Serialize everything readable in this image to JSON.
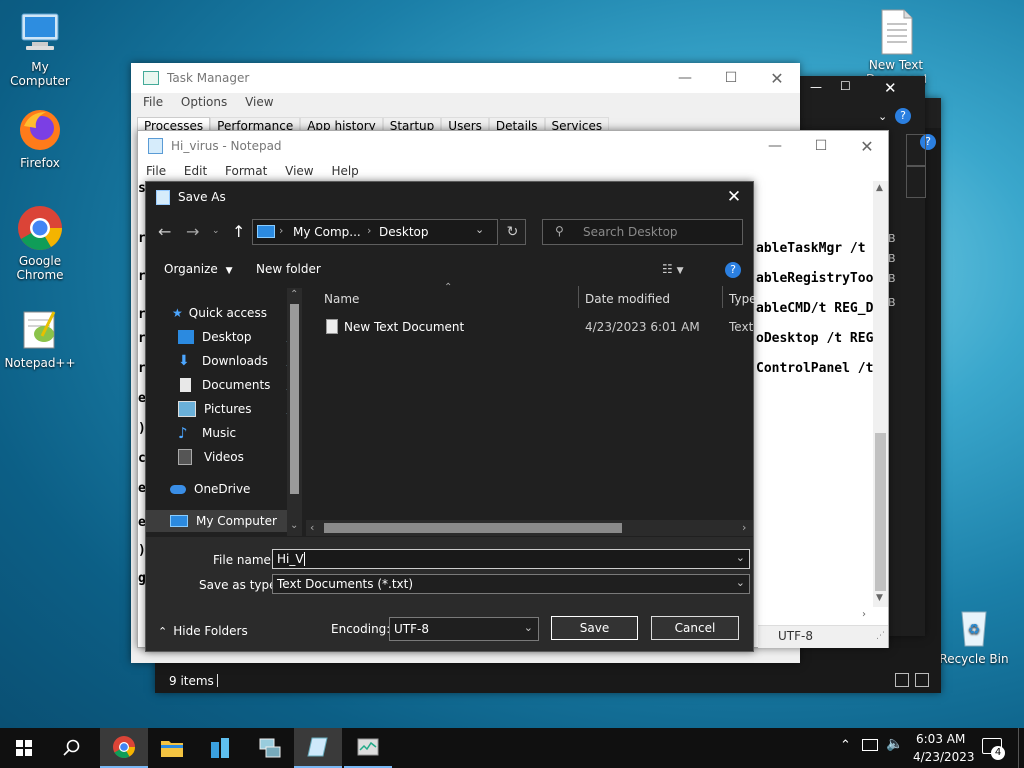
{
  "desktop": {
    "icons": [
      {
        "label": "My Computer"
      },
      {
        "label": "Firefox"
      },
      {
        "label": "Google Chrome"
      },
      {
        "label": "Notepad++"
      },
      {
        "label": "New Text Document"
      },
      {
        "label": "Recycle Bin"
      }
    ]
  },
  "task_manager": {
    "title": "Task Manager",
    "menu": [
      "File",
      "Options",
      "View"
    ],
    "tabs": [
      "Processes",
      "Performance",
      "App history",
      "Startup",
      "Users",
      "Details",
      "Services"
    ]
  },
  "explorer_back": {
    "status": "9 items"
  },
  "notepad": {
    "title": "Hi_virus - Notepad",
    "menu": [
      "File",
      "Edit",
      "Format",
      "View",
      "Help"
    ],
    "left_chars": [
      "s",
      "r",
      "r",
      "r",
      "r",
      "r",
      "e",
      ")",
      "c",
      "e",
      "e",
      ")",
      "g"
    ],
    "right_lines": [
      "ableTaskMgr /t",
      "ableRegistryToo",
      "ableCMD/t REG_D",
      "oDesktop /t REG",
      "ControlPanel /t"
    ],
    "encoding": "UTF-8"
  },
  "save_as": {
    "title": "Save As",
    "path": [
      "My Comp...",
      "Desktop"
    ],
    "search_placeholder": "Search Desktop",
    "organize": "Organize",
    "new_folder": "New folder",
    "nav": [
      {
        "label": "Quick access"
      },
      {
        "label": "Desktop"
      },
      {
        "label": "Downloads"
      },
      {
        "label": "Documents"
      },
      {
        "label": "Pictures"
      },
      {
        "label": "Music"
      },
      {
        "label": "Videos"
      },
      {
        "label": "OneDrive"
      },
      {
        "label": "My Computer"
      }
    ],
    "columns": [
      "Name",
      "Date modified",
      "Type"
    ],
    "files": [
      {
        "name": "New Text Document",
        "date": "4/23/2023 6:01 AM",
        "type": "Text D"
      }
    ],
    "file_name_label": "File name:",
    "file_name_value": "Hi_V",
    "save_type_label": "Save as type:",
    "save_type_value": "Text Documents (*.txt)",
    "hide_folders": "Hide Folders",
    "encoding_label": "Encoding:",
    "encoding_value": "UTF-8",
    "save": "Save",
    "cancel": "Cancel"
  },
  "taskbar": {
    "time": "6:03 AM",
    "date": "4/23/2023",
    "notif_count": "4"
  }
}
